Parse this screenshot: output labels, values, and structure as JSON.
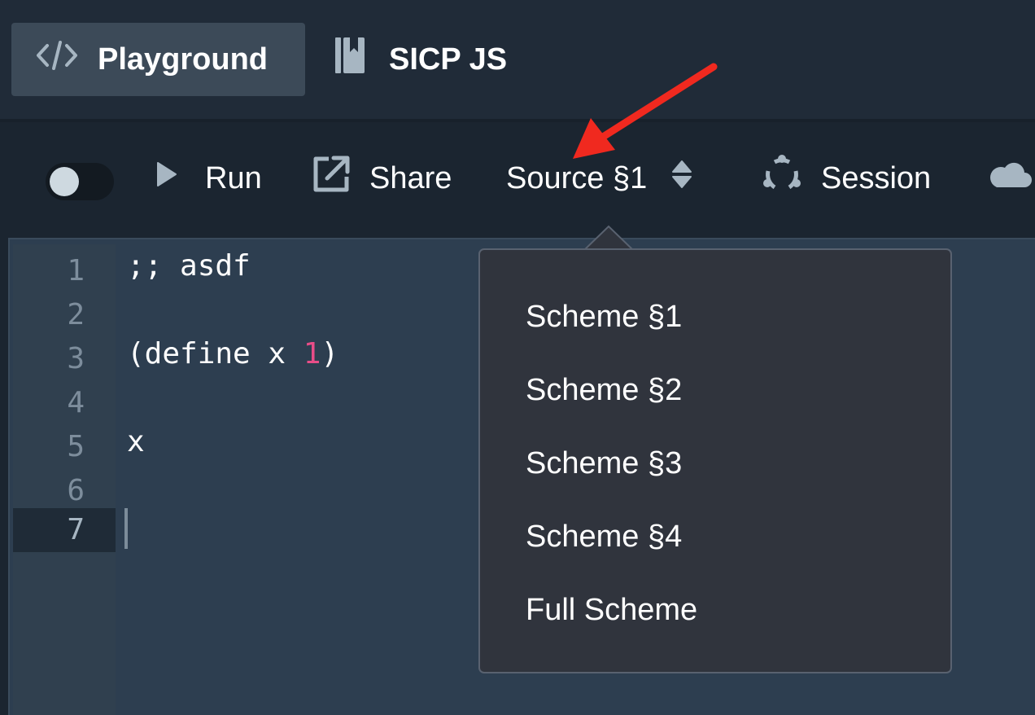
{
  "navbar": {
    "items": [
      {
        "label": "Playground",
        "icon": "code-icon",
        "active": true
      },
      {
        "label": "SICP JS",
        "icon": "book-icon",
        "active": false
      }
    ]
  },
  "toolbar": {
    "toggle_on": false,
    "run_label": "Run",
    "share_label": "Share",
    "source_label": "Source §1",
    "session_label": "Session",
    "cloud_icon": "cloud-icon"
  },
  "editor": {
    "line_numbers": [
      "1",
      "2",
      "3",
      "4",
      "5",
      "6",
      "7"
    ],
    "active_line": "7",
    "lines": [
      {
        "text": ";; asdf"
      },
      {
        "text": ""
      },
      {
        "prefix": "(define x ",
        "number": "1",
        "suffix": ")"
      },
      {
        "text": ""
      },
      {
        "text": "x"
      },
      {
        "text": ""
      },
      {
        "text": ""
      }
    ]
  },
  "source_menu": {
    "options": [
      "Scheme §1",
      "Scheme §2",
      "Scheme §3",
      "Scheme §4",
      "Full Scheme"
    ]
  },
  "colors": {
    "annotation_arrow": "#f0291f",
    "number_literal": "#e84d88",
    "active_nav_bg": "#3c4a58"
  }
}
